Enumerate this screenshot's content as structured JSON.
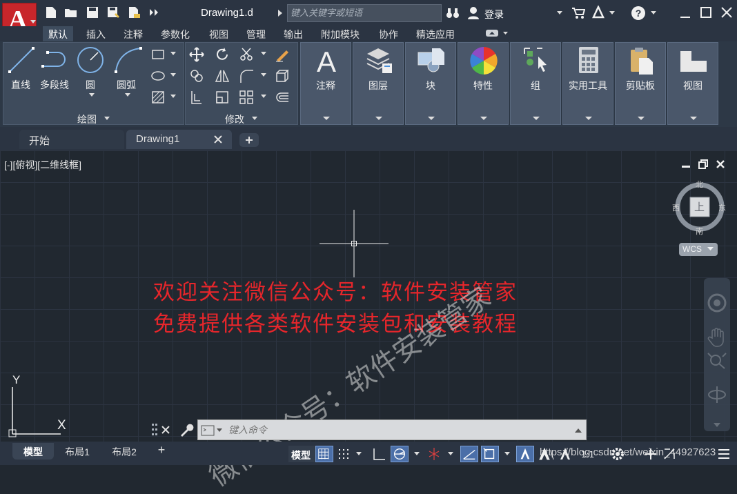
{
  "title_bar": {
    "document_title": "Drawing1.d",
    "search_placeholder": "键入关键字或短语",
    "login_label": "登录"
  },
  "menu_tabs": [
    "默认",
    "插入",
    "注释",
    "参数化",
    "视图",
    "管理",
    "输出",
    "附加模块",
    "协作",
    "精选应用"
  ],
  "ribbon": {
    "draw_tools": [
      "直线",
      "多段线",
      "圆",
      "圆弧"
    ],
    "draw_panel_label": "绘图",
    "modify_panel_label": "修改",
    "big_buttons": [
      "注释",
      "图层",
      "块",
      "特性",
      "组",
      "实用工具",
      "剪贴板",
      "视图"
    ]
  },
  "doc_tabs": {
    "start": "开始",
    "drawing": "Drawing1"
  },
  "canvas": {
    "viewport_label": "[-][俯视][二维线框]",
    "notice_line1": "欢迎关注微信公众号：软件安装管家",
    "notice_line2": "免费提供各类软件安装包和安装教程",
    "watermark_text": "微信公众号：软件安装管家",
    "url_watermark": "https://blog.csdn.net/weixin_44927623",
    "ucs_y": "Y",
    "ucs_x": "X"
  },
  "viewcube": {
    "north": "北",
    "south": "南",
    "west": "西",
    "east": "东",
    "face": "上",
    "wcs": "WCS"
  },
  "command_line": {
    "placeholder": "键入命令"
  },
  "status_bar": {
    "layout_tabs": [
      "模型",
      "布局1",
      "布局2"
    ],
    "add_tab": "+",
    "model_label": "模型"
  },
  "colors": {
    "app_red": "#c8262b",
    "notice_red": "#e6262b",
    "panel_bg": "#3e4b5c",
    "canvas_bg": "#212830"
  }
}
